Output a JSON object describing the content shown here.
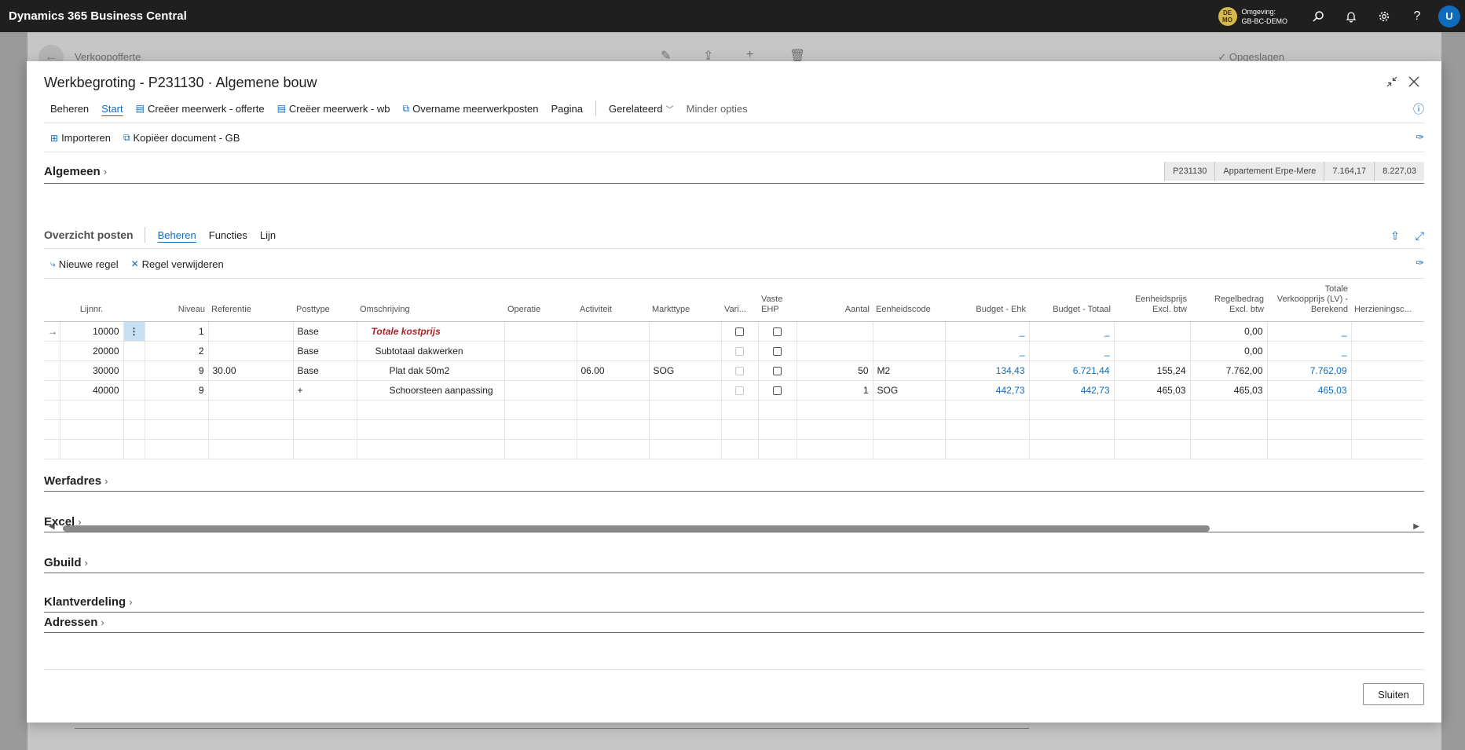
{
  "app": {
    "title": "Dynamics 365 Business Central",
    "env_badge": "DE MO",
    "env_label": "Omgeving:",
    "env_name": "GB-BC-DEMO",
    "user_initial": "U"
  },
  "background_page": {
    "title": "Verkoopofferte",
    "saved_label": "Opgeslagen"
  },
  "dialog": {
    "title": "Werkbegroting - P231130 · Algemene bouw",
    "actions": [
      "Beheren",
      "Start",
      "Creëer meerwerk - offerte",
      "Creëer meerwerk - wb",
      "Overname meerwerkposten",
      "Pagina",
      "Gerelateerd",
      "Minder opties"
    ],
    "promoted": [
      "Importeren",
      "Kopiëer document - GB"
    ],
    "close_label": "Sluiten"
  },
  "general": {
    "title": "Algemeen",
    "summary": [
      "P231130",
      "Appartement Erpe-Mere",
      "7.164,17",
      "8.227,03"
    ]
  },
  "lines": {
    "title": "Overzicht posten",
    "tabs": [
      "Beheren",
      "Functies",
      "Lijn"
    ],
    "actions": [
      "Nieuwe regel",
      "Regel verwijderen"
    ],
    "columns": {
      "lijnnr": "Lijnnr.",
      "niveau": "Niveau",
      "referentie": "Referentie",
      "posttype": "Posttype",
      "omschrijving": "Omschrijving",
      "operatie": "Operatie",
      "activiteit": "Activiteit",
      "markttype": "Markttype",
      "vari": "Vari...",
      "vaste1": "Vaste",
      "vaste2": "EHP",
      "aantal": "Aantal",
      "eenheidscode": "Eenheidscode",
      "budget_ehk": "Budget - Ehk",
      "budget_totaal": "Budget - Totaal",
      "ehp1": "Eenheidsprijs",
      "ehp2": "Excl. btw",
      "rb1": "Regelbedrag",
      "rb2": "Excl. btw",
      "tv1": "Totale",
      "tv2": "Verkoopprijs (LV) -",
      "tv3": "Berekend",
      "herz": "Herzieningsc..."
    },
    "rows": [
      {
        "lijnnr": "10000",
        "niveau": "1",
        "referentie": "",
        "posttype": "Base",
        "omschrijving": "Totale kostprijs",
        "operatie": "",
        "activiteit": "",
        "markttype": "",
        "aantal": "",
        "eenheidscode": "",
        "budget_ehk": "_",
        "budget_totaal": "_",
        "eenheidsprijs": "",
        "regelbedrag": "0,00",
        "totale_vp": "_"
      },
      {
        "lijnnr": "20000",
        "niveau": "2",
        "referentie": "",
        "posttype": "Base",
        "omschrijving": "Subtotaal dakwerken",
        "operatie": "",
        "activiteit": "",
        "markttype": "",
        "aantal": "",
        "eenheidscode": "",
        "budget_ehk": "_",
        "budget_totaal": "_",
        "eenheidsprijs": "",
        "regelbedrag": "0,00",
        "totale_vp": "_"
      },
      {
        "lijnnr": "30000",
        "niveau": "9",
        "referentie": "30.00",
        "posttype": "Base",
        "omschrijving": "Plat dak 50m2",
        "operatie": "",
        "activiteit": "06.00",
        "markttype": "SOG",
        "aantal": "50",
        "eenheidscode": "M2",
        "budget_ehk": "134,43",
        "budget_totaal": "6.721,44",
        "eenheidsprijs": "155,24",
        "regelbedrag": "7.762,00",
        "totale_vp": "7.762,09"
      },
      {
        "lijnnr": "40000",
        "niveau": "9",
        "referentie": "",
        "posttype": "+",
        "omschrijving": "Schoorsteen aanpassing",
        "operatie": "",
        "activiteit": "",
        "markttype": "",
        "aantal": "1",
        "eenheidscode": "SOG",
        "budget_ehk": "442,73",
        "budget_totaal": "442,73",
        "eenheidsprijs": "465,03",
        "regelbedrag": "465,03",
        "totale_vp": "465,03"
      }
    ]
  },
  "fasttabs": [
    "Werfadres",
    "Excel",
    "Gbuild",
    "Klantverdeling",
    "Adressen"
  ],
  "colors": {
    "accent": "#0f6cbd",
    "total_red": "#a4262c",
    "appbar": "#1f1f1f"
  }
}
